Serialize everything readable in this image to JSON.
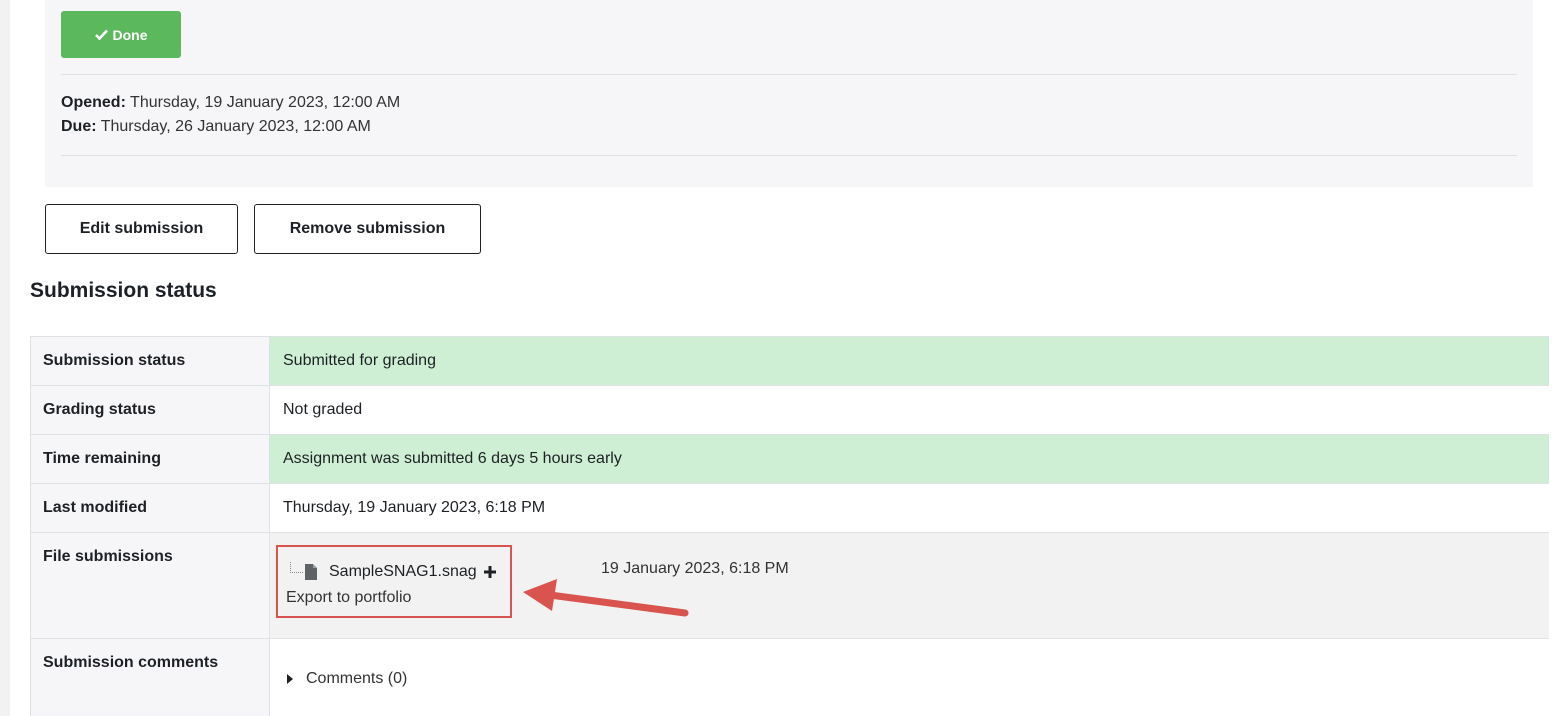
{
  "activity": {
    "done_label": "Done",
    "opened_label": "Opened:",
    "opened_value": "Thursday, 19 January 2023, 12:00 AM",
    "due_label": "Due:",
    "due_value": "Thursday, 26 January 2023, 12:00 AM"
  },
  "actions": {
    "edit_label": "Edit submission",
    "remove_label": "Remove submission"
  },
  "section_title": "Submission status",
  "rows": [
    {
      "label": "Submission status",
      "value": "Submitted for grading",
      "style": "green"
    },
    {
      "label": "Grading status",
      "value": "Not graded",
      "style": "white"
    },
    {
      "label": "Time remaining",
      "value": "Assignment was submitted 6 days 5 hours early",
      "style": "green"
    },
    {
      "label": "Last modified",
      "value": "Thursday, 19 January 2023, 6:18 PM",
      "style": "white"
    },
    {
      "label": "File submissions",
      "file_name": "SampleSNAG1.snag",
      "export_label": "Export to portfolio",
      "file_date": "19 January 2023, 6:18 PM",
      "style": "gray"
    },
    {
      "label": "Submission comments",
      "comments_label": "Comments (0)",
      "style": "white"
    }
  ],
  "colors": {
    "done_green": "#5cb85c",
    "success_row": "#cfefd4",
    "highlight_red": "#d9534f"
  }
}
